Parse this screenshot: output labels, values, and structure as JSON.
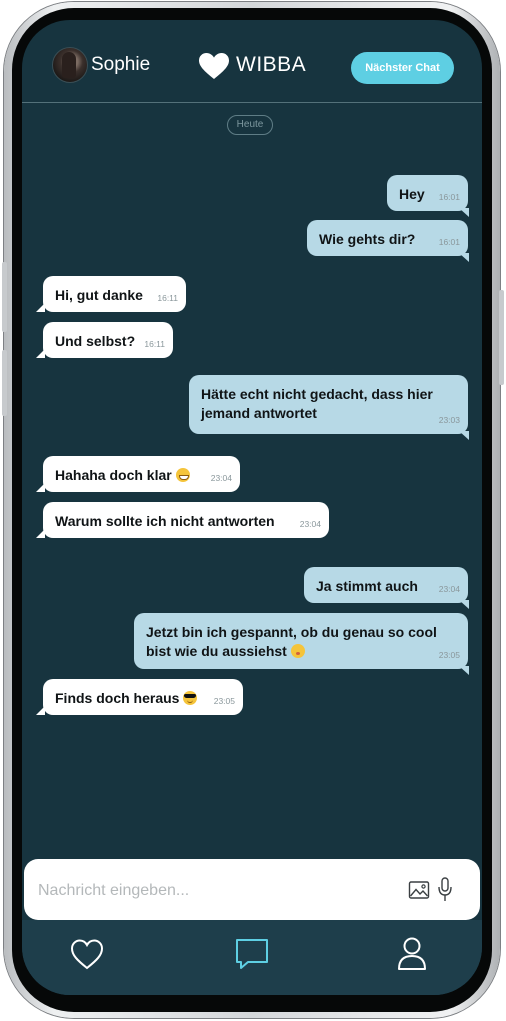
{
  "header": {
    "contact_name": "Sophie",
    "brand": "WIBBA",
    "next_chat_label": "Nächster Chat"
  },
  "date_divider": "Heute",
  "messages": [
    {
      "direction": "out",
      "text": "Hey",
      "time": "16:01"
    },
    {
      "direction": "out",
      "text": "Wie gehts dir?",
      "time": "16:01"
    },
    {
      "direction": "in",
      "text": "Hi, gut danke",
      "time": "16:11"
    },
    {
      "direction": "in",
      "text": "Und selbst?",
      "time": "16:11"
    },
    {
      "direction": "out",
      "text_line1": "Hätte echt nicht gedacht, dass hier",
      "text_line2": "jemand antwortet",
      "time": "23:03"
    },
    {
      "direction": "in",
      "text": "Hahaha doch klar",
      "emoji": "grinning-face-icon",
      "time": "23:04"
    },
    {
      "direction": "in",
      "text": "Warum sollte ich nicht antworten",
      "time": "23:04"
    },
    {
      "direction": "out",
      "text": "Ja stimmt auch",
      "time": "23:04"
    },
    {
      "direction": "out",
      "text_line1": "Jetzt bin ich gespannt, ob du genau so cool",
      "text_line2": "bist wie du aussiehst",
      "emoji": "kissing-wink-face-icon",
      "time": "23:05"
    },
    {
      "direction": "in",
      "text": "Finds doch heraus",
      "emoji": "sunglasses-face-icon",
      "time": "23:05"
    }
  ],
  "composer": {
    "placeholder": "Nachricht eingeben...",
    "value": ""
  },
  "nav": [
    {
      "icon": "heart-icon",
      "active": false
    },
    {
      "icon": "chat-icon",
      "active": true
    },
    {
      "icon": "profile-icon",
      "active": false
    }
  ],
  "colors": {
    "screen_bg": "#17343f",
    "outgoing_bubble": "#b7d9e6",
    "incoming_bubble": "#ffffff",
    "accent": "#5ecfe3",
    "nav_bg": "#1e3e4b"
  }
}
